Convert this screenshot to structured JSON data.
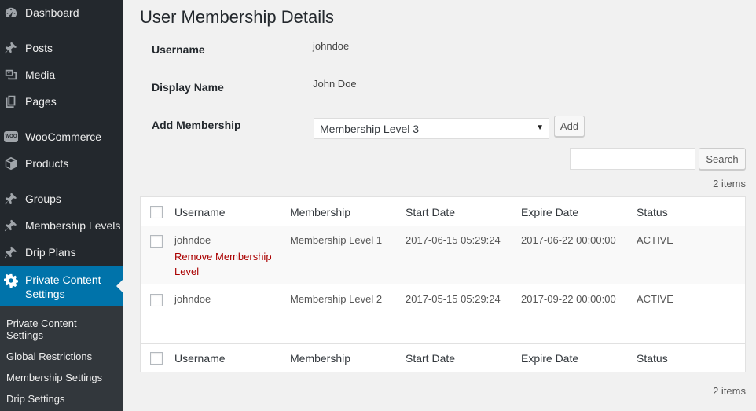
{
  "sidebar": {
    "items": [
      {
        "label": "Dashboard",
        "icon": "dashboard-icon"
      },
      {
        "label": "Posts",
        "icon": "pin-icon"
      },
      {
        "label": "Media",
        "icon": "media-icon"
      },
      {
        "label": "Pages",
        "icon": "pages-icon"
      },
      {
        "label": "WooCommerce",
        "icon": "woocommerce-icon",
        "badge": "WOO"
      },
      {
        "label": "Products",
        "icon": "box-icon"
      },
      {
        "label": "Groups",
        "icon": "pin-icon"
      },
      {
        "label": "Membership Levels",
        "icon": "pin-icon"
      },
      {
        "label": "Drip Plans",
        "icon": "pin-icon"
      },
      {
        "label": "Private Content Settings",
        "icon": "gear-icon",
        "active": true
      }
    ],
    "submenu": [
      "Private Content Settings",
      "Global Restrictions",
      "Membership Settings",
      "Drip Settings"
    ]
  },
  "page": {
    "title": "User Membership Details",
    "fields": {
      "username_label": "Username",
      "username_value": "johndoe",
      "display_name_label": "Display Name",
      "display_name_value": "John Doe",
      "add_membership_label": "Add Membership",
      "membership_selected": "Membership Level 3",
      "add_button": "Add"
    },
    "search": {
      "button": "Search",
      "value": ""
    },
    "items_count_top": "2 items",
    "items_count_bottom": "2 items"
  },
  "table": {
    "columns": [
      "Username",
      "Membership",
      "Start Date",
      "Expire Date",
      "Status"
    ],
    "rows": [
      {
        "username": "johndoe",
        "membership": "Membership Level 1",
        "start": "2017-06-15 05:29:24",
        "expire": "2017-06-22 00:00:00",
        "status": "ACTIVE",
        "action": "Remove Membership Level"
      },
      {
        "username": "johndoe",
        "membership": "Membership Level 2",
        "start": "2017-05-15 05:29:24",
        "expire": "2017-09-22 00:00:00",
        "status": "ACTIVE"
      }
    ]
  },
  "colors": {
    "sidebar_bg": "#23282d",
    "active_bg": "#0073aa",
    "submenu_bg": "#32373c",
    "remove_link": "#aa0000"
  }
}
